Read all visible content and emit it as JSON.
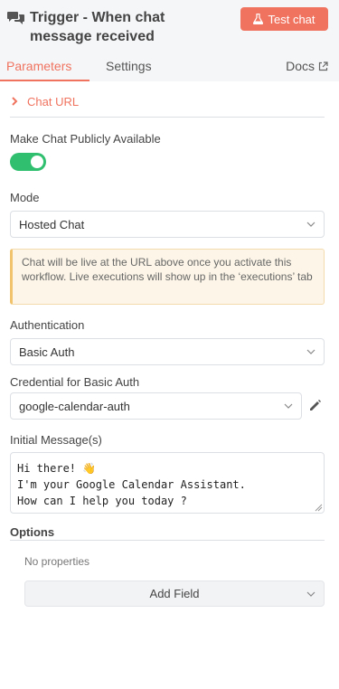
{
  "header": {
    "title": "Trigger - When chat message received",
    "test_button_label": "Test chat"
  },
  "tabs": [
    {
      "label": "Parameters",
      "active": true
    },
    {
      "label": "Settings",
      "active": false
    }
  ],
  "docs_label": "Docs",
  "chat_url": {
    "label": "Chat URL",
    "expanded": false
  },
  "public": {
    "label": "Make Chat Publicly Available",
    "enabled": true
  },
  "mode": {
    "label": "Mode",
    "value": "Hosted Chat"
  },
  "notice": "Chat will be live at the URL above once you activate this workflow. Live executions will show up in the ‘executions’ tab",
  "authentication": {
    "label": "Authentication",
    "value": "Basic Auth"
  },
  "credential": {
    "label": "Credential for Basic Auth",
    "value": "google-calendar-auth"
  },
  "initial_messages": {
    "label": "Initial Message(s)",
    "value": "Hi there! 👋\nI'm your Google Calendar Assistant.\nHow can I help you today ?"
  },
  "options": {
    "label": "Options",
    "empty_text": "No properties",
    "add_field_label": "Add Field"
  },
  "colors": {
    "accent": "#f0735f",
    "toggle_on": "#2fbf6e",
    "notice_bg": "#fdf6e8"
  }
}
